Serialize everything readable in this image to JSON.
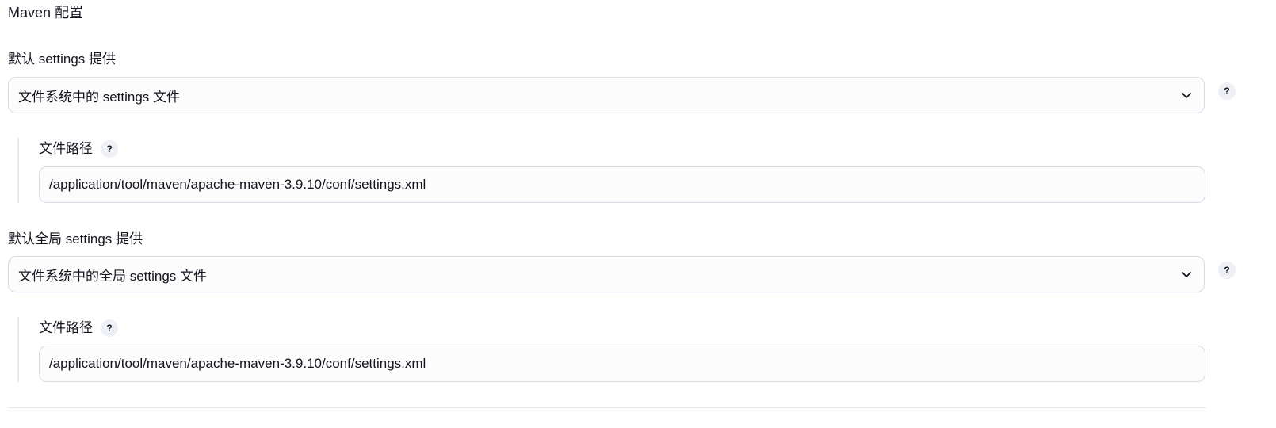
{
  "section": {
    "title": "Maven 配置"
  },
  "settings": {
    "label": "默认 settings 提供",
    "selected": "文件系统中的 settings 文件",
    "help": "?",
    "path_label": "文件路径",
    "path_help": "?",
    "path_value": "/application/tool/maven/apache-maven-3.9.10/conf/settings.xml"
  },
  "global_settings": {
    "label": "默认全局 settings 提供",
    "selected": "文件系统中的全局 settings 文件",
    "help": "?",
    "path_label": "文件路径",
    "path_help": "?",
    "path_value": "/application/tool/maven/apache-maven-3.9.10/conf/settings.xml"
  },
  "icons": {
    "dropdown": "chevron-down-icon",
    "help": "question-mark-icon"
  },
  "colors": {
    "border": "#d8dbe6",
    "field_bg": "#fcfcfd",
    "help_bg": "#eef0f5",
    "text": "#14141f"
  }
}
